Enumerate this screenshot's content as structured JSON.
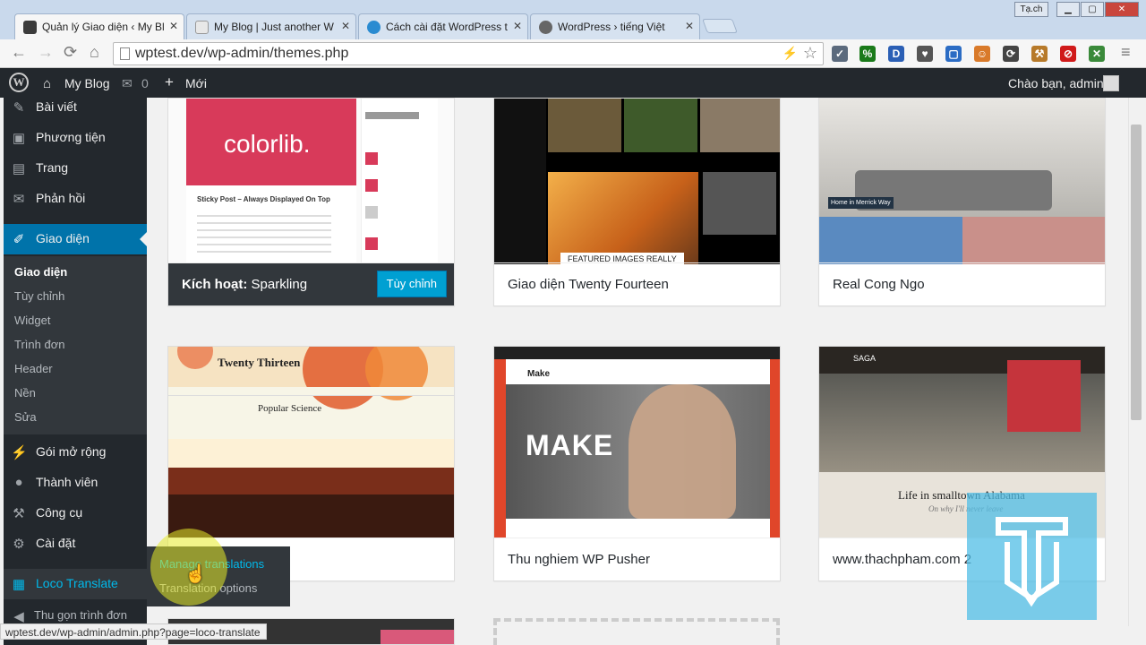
{
  "browser": {
    "tabs": [
      {
        "title": "Quản lý Giao diện ‹ My Bl",
        "favicon_color": "#3b3b3b"
      },
      {
        "title": "My Blog | Just another W",
        "favicon_color": "#888888"
      },
      {
        "title": "Cách cài đặt WordPress t",
        "favicon_color": "#2a8bd1"
      },
      {
        "title": "WordPress › tiếng Việt",
        "favicon_color": "#666666"
      }
    ],
    "window_label": "Tạ.ch",
    "url": "wptest.dev/wp-admin/themes.php",
    "extensions": [
      {
        "icon": "check-icon",
        "color": "#5b6a7d",
        "glyph": "✓"
      },
      {
        "icon": "percent-icon",
        "color": "#1a7a1a",
        "glyph": "%"
      },
      {
        "icon": "d-icon",
        "color": "#2b5fb5",
        "glyph": "D"
      },
      {
        "icon": "pocket-icon",
        "color": "#555555",
        "glyph": "♥"
      },
      {
        "icon": "screenshot-icon",
        "color": "#2b6cc4",
        "glyph": "▢"
      },
      {
        "icon": "face-icon",
        "color": "#d97a2a",
        "glyph": "☺"
      },
      {
        "icon": "sync-icon",
        "color": "#444444",
        "glyph": "⟳"
      },
      {
        "icon": "hammer-icon",
        "color": "#b77a2a",
        "glyph": "⚒"
      },
      {
        "icon": "block-icon",
        "color": "#d01a1a",
        "glyph": "⊘"
      },
      {
        "icon": "puzzle-icon",
        "color": "#3a8a3a",
        "glyph": "✕"
      }
    ]
  },
  "adminbar": {
    "site_name": "My Blog",
    "comments_count": "0",
    "new_label": "Mới",
    "greeting": "Chào bạn, admin"
  },
  "sidebar": {
    "items": [
      {
        "label": "Bài viết",
        "icon": "pin-icon",
        "glyph": "✎"
      },
      {
        "label": "Phương tiện",
        "icon": "media-icon",
        "glyph": "▣"
      },
      {
        "label": "Trang",
        "icon": "page-icon",
        "glyph": "▤"
      },
      {
        "label": "Phản hồi",
        "icon": "comment-icon",
        "glyph": "✉"
      },
      {
        "label": "Giao diện",
        "icon": "brush-icon",
        "glyph": "✐"
      },
      {
        "label": "Gói mở rộng",
        "icon": "plugin-icon",
        "glyph": "⚡"
      },
      {
        "label": "Thành viên",
        "icon": "user-icon",
        "glyph": "●"
      },
      {
        "label": "Công cụ",
        "icon": "wrench-icon",
        "glyph": "⚒"
      },
      {
        "label": "Cài đặt",
        "icon": "settings-icon",
        "glyph": "⚙"
      },
      {
        "label": "Loco Translate",
        "icon": "translate-icon",
        "glyph": "▦"
      },
      {
        "label": "Thu gọn trình đơn",
        "icon": "collapse-icon",
        "glyph": "◀"
      }
    ],
    "submenu": [
      "Giao diện",
      "Tùy chỉnh",
      "Widget",
      "Trình đơn",
      "Header",
      "Nền",
      "Sửa"
    ]
  },
  "flyout": {
    "items": [
      "Manage translations",
      "Translation options"
    ]
  },
  "themes": [
    {
      "name": "Sparkling",
      "active_prefix": "Kích hoạt:",
      "button": "Tùy chỉnh",
      "active": true
    },
    {
      "name": "Giao diện Twenty Fourteen"
    },
    {
      "name": "Real Cong Ngo"
    },
    {
      "name": ""
    },
    {
      "name": "Thu nghiem WP Pusher"
    },
    {
      "name": "www.thachpham.com 2"
    }
  ],
  "screenshots": {
    "colorlib_logo": "colorlib.",
    "colorlib_post": "Sticky Post – Always Displayed On Top",
    "twenty_thirteen_title": "Twenty Thirteen",
    "twenty_thirteen_post": "Popular Science",
    "make_logo": "Make",
    "make_hero": "MAKE",
    "saga_logo": "SAGA",
    "saga_title": "Life in smalltown Alabama",
    "saga_sub": "On why I'll never leave",
    "fourteen_caption": "FEATURED IMAGES REALLY",
    "realhome_caption": "Home in Merrick Way"
  },
  "status_url": "wptest.dev/wp-admin/admin.php?page=loco-translate"
}
